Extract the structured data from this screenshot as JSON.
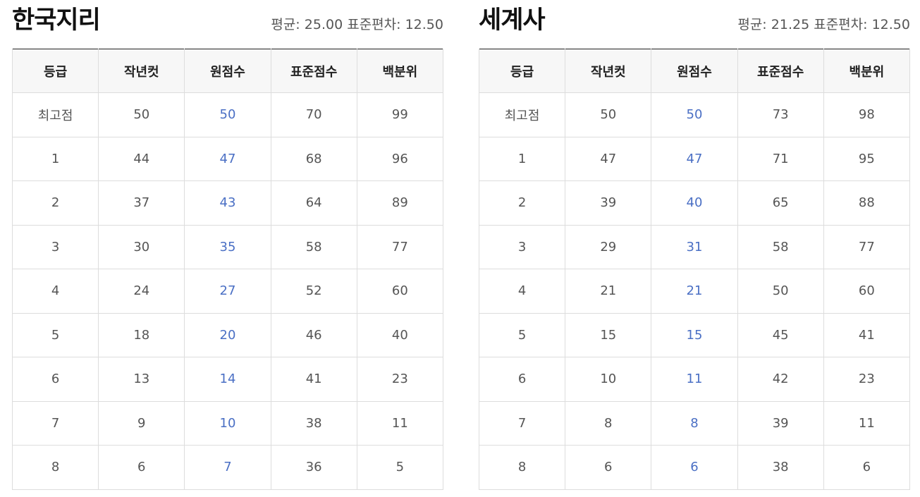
{
  "colors": {
    "raw_score": "#4a6fc4",
    "header_bg": "#f7f7f7",
    "border": "#dddddd",
    "top_border": "#222222"
  },
  "panels": [
    {
      "title": "한국지리",
      "stats": {
        "mean_label": "평균:",
        "mean": "25.00",
        "sd_label": "표준편차:",
        "sd": "12.50"
      },
      "headers": [
        "등급",
        "작년컷",
        "원점수",
        "표준점수",
        "백분위"
      ],
      "rows": [
        [
          "최고점",
          "50",
          "50",
          "70",
          "99"
        ],
        [
          "1",
          "44",
          "47",
          "68",
          "96"
        ],
        [
          "2",
          "37",
          "43",
          "64",
          "89"
        ],
        [
          "3",
          "30",
          "35",
          "58",
          "77"
        ],
        [
          "4",
          "24",
          "27",
          "52",
          "60"
        ],
        [
          "5",
          "18",
          "20",
          "46",
          "40"
        ],
        [
          "6",
          "13",
          "14",
          "41",
          "23"
        ],
        [
          "7",
          "9",
          "10",
          "38",
          "11"
        ],
        [
          "8",
          "6",
          "7",
          "36",
          "5"
        ]
      ]
    },
    {
      "title": "세계사",
      "stats": {
        "mean_label": "평균:",
        "mean": "21.25",
        "sd_label": "표준편차:",
        "sd": "12.50"
      },
      "headers": [
        "등급",
        "작년컷",
        "원점수",
        "표준점수",
        "백분위"
      ],
      "rows": [
        [
          "최고점",
          "50",
          "50",
          "73",
          "98"
        ],
        [
          "1",
          "47",
          "47",
          "71",
          "95"
        ],
        [
          "2",
          "39",
          "40",
          "65",
          "88"
        ],
        [
          "3",
          "29",
          "31",
          "58",
          "77"
        ],
        [
          "4",
          "21",
          "21",
          "50",
          "60"
        ],
        [
          "5",
          "15",
          "15",
          "45",
          "41"
        ],
        [
          "6",
          "10",
          "11",
          "42",
          "23"
        ],
        [
          "7",
          "8",
          "8",
          "39",
          "11"
        ],
        [
          "8",
          "6",
          "6",
          "38",
          "6"
        ]
      ]
    }
  ]
}
